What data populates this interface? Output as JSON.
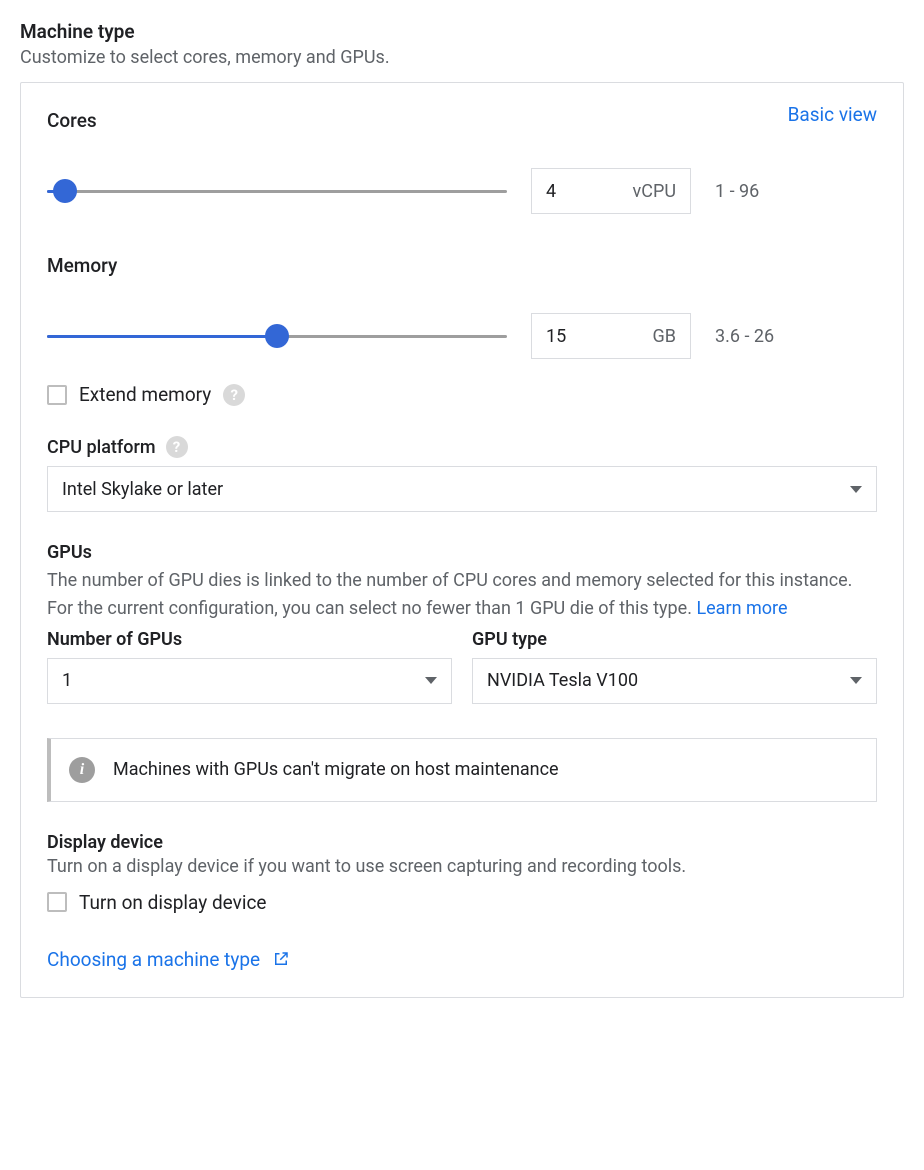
{
  "header": {
    "title": "Machine type",
    "subtitle": "Customize to select cores, memory and GPUs."
  },
  "basic_view_link": "Basic view",
  "cores": {
    "label": "Cores",
    "value": "4",
    "unit": "vCPU",
    "range": "1 - 96",
    "fill_pct": 4
  },
  "memory": {
    "label": "Memory",
    "value": "15",
    "unit": "GB",
    "range": "3.6 - 26",
    "fill_pct": 50
  },
  "extend_memory": {
    "label": "Extend memory"
  },
  "cpu_platform": {
    "label": "CPU platform",
    "value": "Intel Skylake or later"
  },
  "gpus": {
    "title": "GPUs",
    "desc_1": "The number of GPU dies is linked to the number of CPU cores and memory selected for this instance. For the current configuration, you can select no fewer than 1 GPU die of this type. ",
    "learn_more": "Learn more",
    "num_label": "Number of GPUs",
    "num_value": "1",
    "type_label": "GPU type",
    "type_value": "NVIDIA Tesla V100"
  },
  "info_msg": "Machines with GPUs can't migrate on host maintenance",
  "display": {
    "title": "Display device",
    "subtitle": "Turn on a display device if you want to use screen capturing and recording tools.",
    "checkbox_label": "Turn on display device"
  },
  "bottom_link": "Choosing a machine type"
}
